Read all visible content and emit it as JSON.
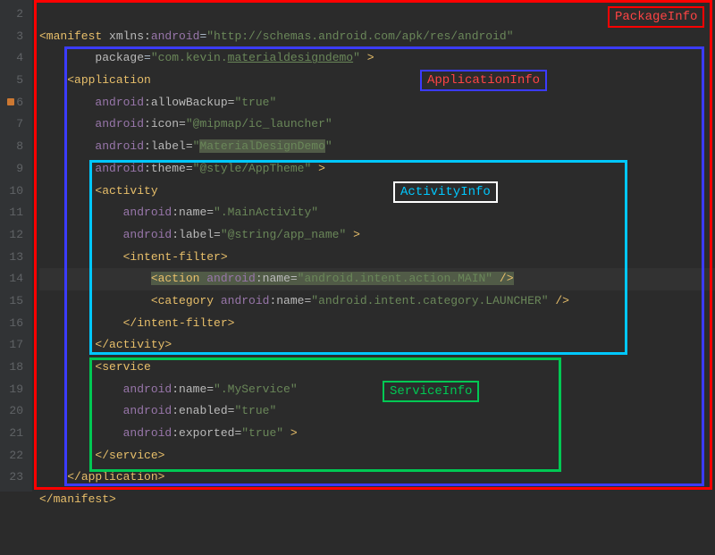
{
  "lineNumbers": [
    "2",
    "3",
    "4",
    "5",
    "6",
    "7",
    "8",
    "9",
    "10",
    "11",
    "12",
    "13",
    "14",
    "15",
    "16",
    "17",
    "18",
    "19",
    "20",
    "21",
    "22",
    "23"
  ],
  "markerLine": "6",
  "labels": {
    "package": "PackageInfo",
    "application": "ApplicationInfo",
    "activity": "ActivityInfo",
    "service": "ServiceInfo"
  },
  "code": {
    "l2a": "<manifest ",
    "l2b": "xmlns:",
    "l2c": "android",
    "l2d": "=",
    "l2e": "\"http://schemas.android.com/apk/res/android\"",
    "l3a": "package",
    "l3b": "=",
    "l3c": "\"com.kevin.",
    "l3d": "materialdesigndemo",
    "l3e": "\"",
    "l3f": " >",
    "l4a": "<application",
    "l5a": "android",
    "l5b": ":allowBackup=",
    "l5c": "\"true\"",
    "l6a": "android",
    "l6b": ":icon=",
    "l6c": "\"@mipmap/ic_launcher\"",
    "l7a": "android",
    "l7b": ":label=",
    "l7c": "\"",
    "l7d": "MaterialDesignDemo",
    "l7e": "\"",
    "l8a": "android",
    "l8b": ":theme=",
    "l8c": "\"@style/AppTheme\"",
    "l8d": " >",
    "l9a": "<activity",
    "l10a": "android",
    "l10b": ":name=",
    "l10c": "\".MainActivity\"",
    "l11a": "android",
    "l11b": ":label=",
    "l11c": "\"@string/app_name\"",
    "l11d": " >",
    "l12a": "<intent-filter>",
    "l13a": "<action ",
    "l13b": "android",
    "l13c": ":name=",
    "l13d": "\"android.intent.action.MAIN\"",
    "l13e": " />",
    "l14a": "<category ",
    "l14b": "android",
    "l14c": ":name=",
    "l14d": "\"android.intent.category.LAUNCHER\"",
    "l14e": " />",
    "l15a": "</intent-filter>",
    "l16a": "</activity>",
    "l17a": "<service",
    "l18a": "android",
    "l18b": ":name=",
    "l18c": "\".MyService\"",
    "l19a": "android",
    "l19b": ":enabled=",
    "l19c": "\"true\"",
    "l20a": "android",
    "l20b": ":exported=",
    "l20c": "\"true\"",
    "l20d": " >",
    "l21a": "</service>",
    "l22a": "</application>",
    "l23a": "</manifest>"
  }
}
